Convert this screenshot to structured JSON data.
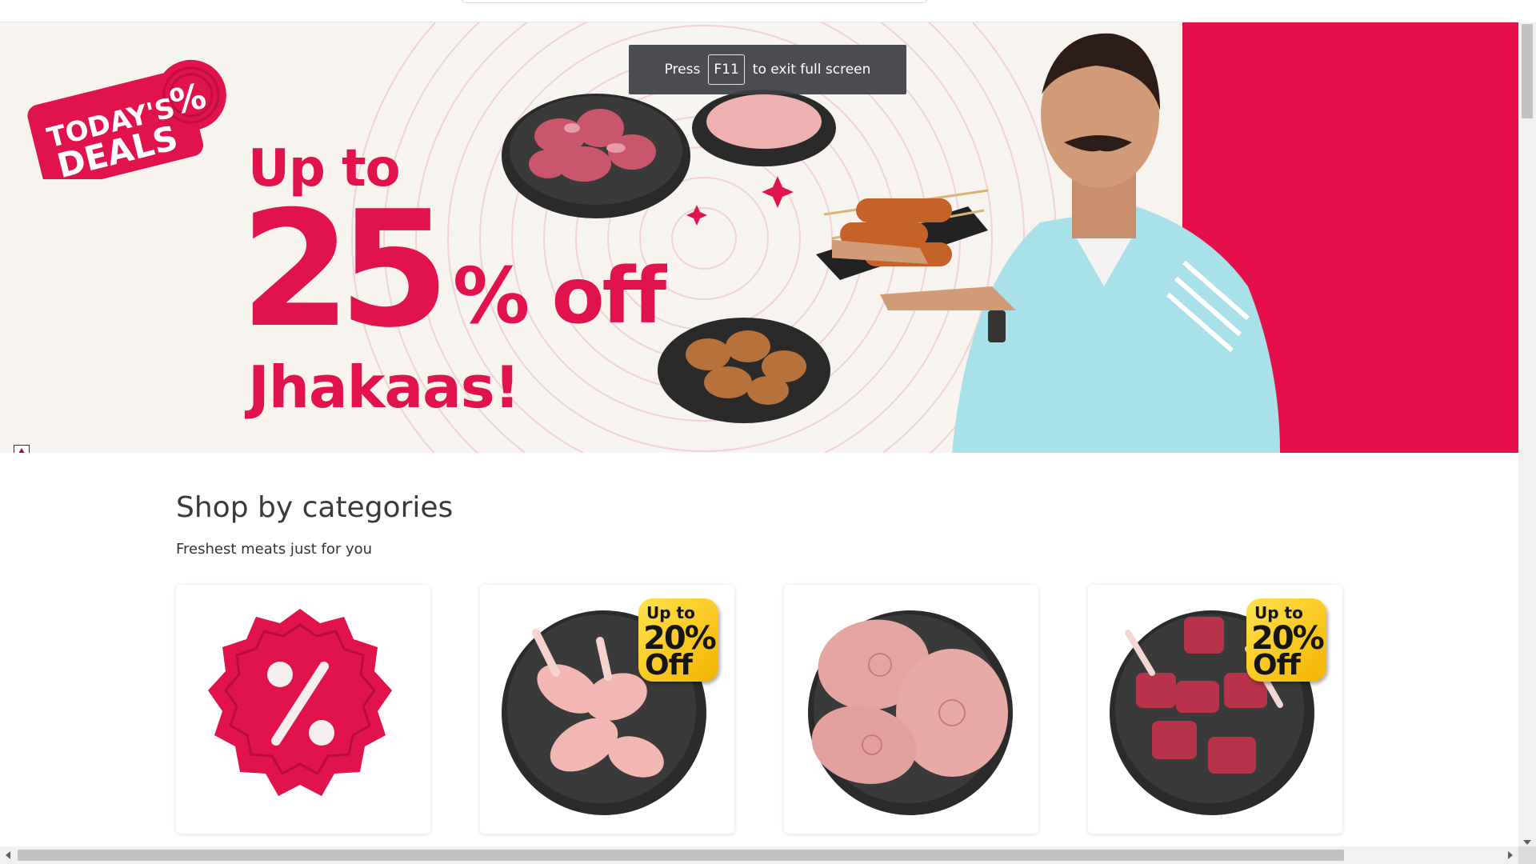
{
  "hero": {
    "badge_line1": "TODAY'S",
    "badge_line2": "DEALS",
    "badge_symbol": "%",
    "promo_prefix": "Up to",
    "promo_number": "25",
    "promo_suffix": "% off",
    "promo_tagline": "Jhakaas!",
    "brand_color": "#e0134c"
  },
  "fullscreen_toast": {
    "press": "Press",
    "key": "F11",
    "suffix": "to exit full screen"
  },
  "categories": {
    "title": "Shop by categories",
    "subtitle": "Freshest meats just for you",
    "cards": [
      {
        "icon": "percent-badge-icon",
        "discount_badge": null
      },
      {
        "icon": "chicken-plate-image",
        "discount_badge": {
          "line1": "Up to",
          "line2": "20%",
          "line3": "Off"
        }
      },
      {
        "icon": "fish-steaks-image",
        "discount_badge": null
      },
      {
        "icon": "mutton-plate-image",
        "discount_badge": {
          "line1": "Up to",
          "line2": "20%",
          "line3": "Off"
        }
      }
    ]
  },
  "icons": {
    "ad_choices": "ad-choices-icon"
  }
}
